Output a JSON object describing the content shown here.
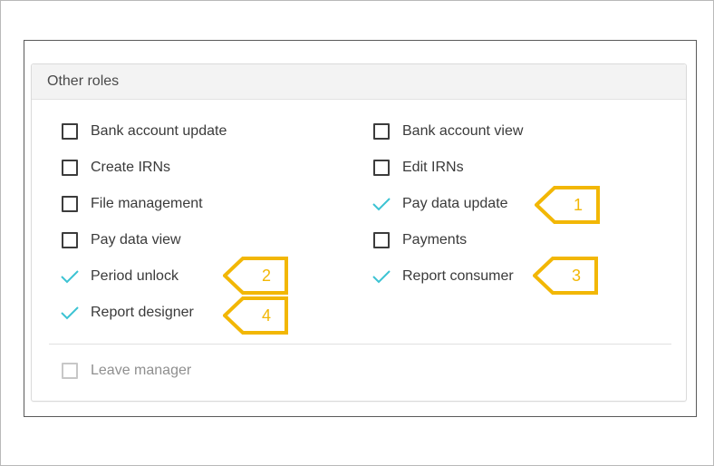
{
  "panel": {
    "title": "Other roles"
  },
  "roles": [
    {
      "label": "Bank account update",
      "checked": false
    },
    {
      "label": "Bank account view",
      "checked": false
    },
    {
      "label": "Create IRNs",
      "checked": false
    },
    {
      "label": "Edit IRNs",
      "checked": false
    },
    {
      "label": "File management",
      "checked": false
    },
    {
      "label": "Pay data update",
      "checked": true
    },
    {
      "label": "Pay data view",
      "checked": false
    },
    {
      "label": "Payments",
      "checked": false
    },
    {
      "label": "Period unlock",
      "checked": true
    },
    {
      "label": "Report consumer",
      "checked": true
    },
    {
      "label": "Report designer",
      "checked": true
    }
  ],
  "extra_role": {
    "label": "Leave manager",
    "checked": false,
    "disabled": true
  },
  "callouts": [
    {
      "number": "1"
    },
    {
      "number": "2"
    },
    {
      "number": "3"
    },
    {
      "number": "4"
    }
  ],
  "colors": {
    "check": "#3cc3d3",
    "callout": "#f2b705",
    "checkbox_border": "#3c3c3c"
  }
}
